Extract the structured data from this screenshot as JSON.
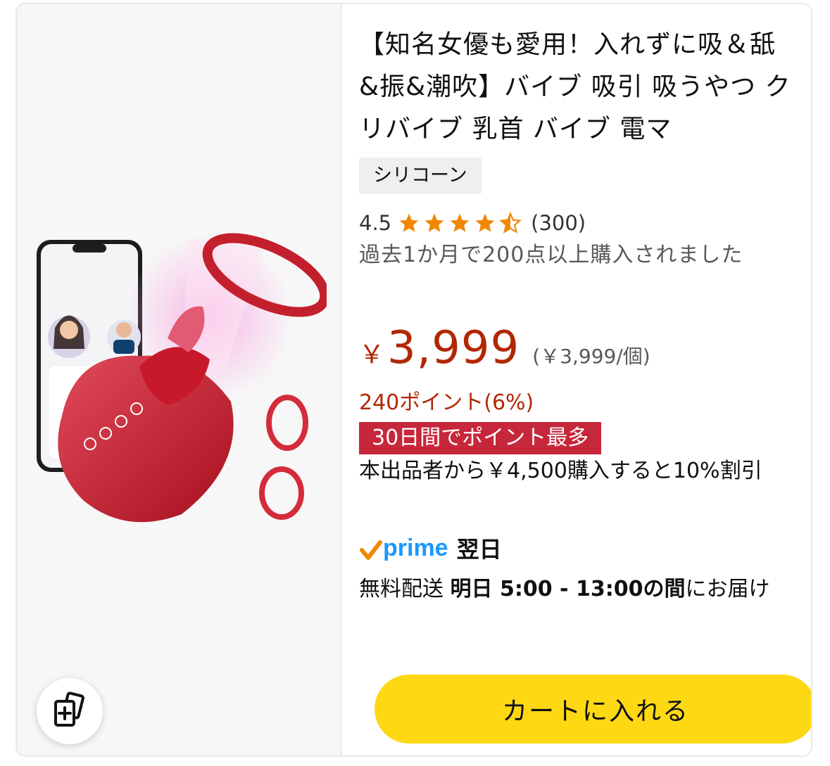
{
  "product": {
    "title": "【知名女優も愛用！入れずに吸＆舐&振&潮吹】バイブ 吸引 吸うやつ クリバイブ 乳首 バイブ 電マ",
    "variant": "シリコーン",
    "rating": {
      "score": "4.5",
      "stars": 4.5,
      "count": "(300)"
    },
    "bought_text": "過去1か月で200点以上購入されました",
    "price": {
      "symbol": "￥",
      "amount": "3,999",
      "unit_price": "(￥3,999/個)"
    },
    "points": "240ポイント(6%)",
    "points_badge": "30日間でポイント最多",
    "discount_text": "本出品者から￥4,500購入すると10%割引",
    "prime": {
      "logo_text": "prime",
      "speed": "翌日"
    },
    "delivery": {
      "prefix": "無料配送 ",
      "date": "明日 5:00 - 13:00の間",
      "suffix": "にお届け"
    },
    "cart_button": "カートに入れる"
  },
  "image": {
    "icon": "product-photo-rose-toy",
    "compare_icon": "add-to-compare-icon"
  },
  "colors": {
    "price": "#b12704",
    "badge_bg": "#c7273b",
    "star": "#f08804",
    "prime_blue": "#1a98ff",
    "prime_check": "#f08804",
    "cart_button": "#ffd814"
  }
}
